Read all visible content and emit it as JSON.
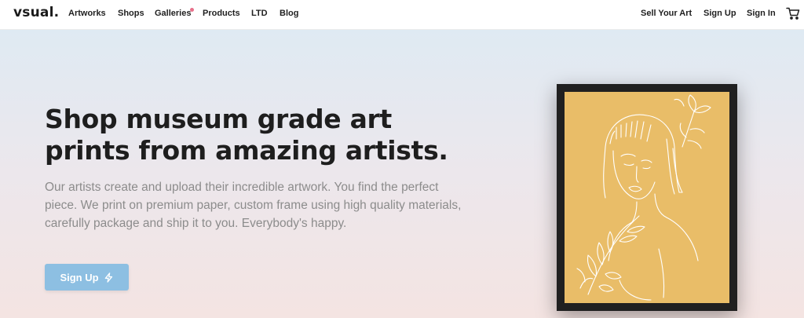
{
  "brand": {
    "logo": "vsual."
  },
  "nav": {
    "left": [
      "Artworks",
      "Shops",
      "Galleries",
      "Products",
      "LTD",
      "Blog"
    ],
    "right": [
      "Sell Your Art",
      "Sign Up",
      "Sign In"
    ],
    "cart_icon": "cart-icon",
    "galleries_dot_color": "#e8708a"
  },
  "hero": {
    "headline_line1": "Shop museum grade art",
    "headline_line2": "prints from amazing artists.",
    "subtext": "Our artists create and upload their incredible artwork. You find the perfect piece. We print on premium paper, custom frame using high quality materials, carefully package and ship it to you. Everybody's happy.",
    "cta_label": "Sign Up",
    "cta_icon": "lightning-icon",
    "cta_color": "#8dbfe2"
  },
  "artwork": {
    "frame_color": "#202020",
    "background_color": "#e9bd68",
    "line_color": "#ffffff"
  }
}
